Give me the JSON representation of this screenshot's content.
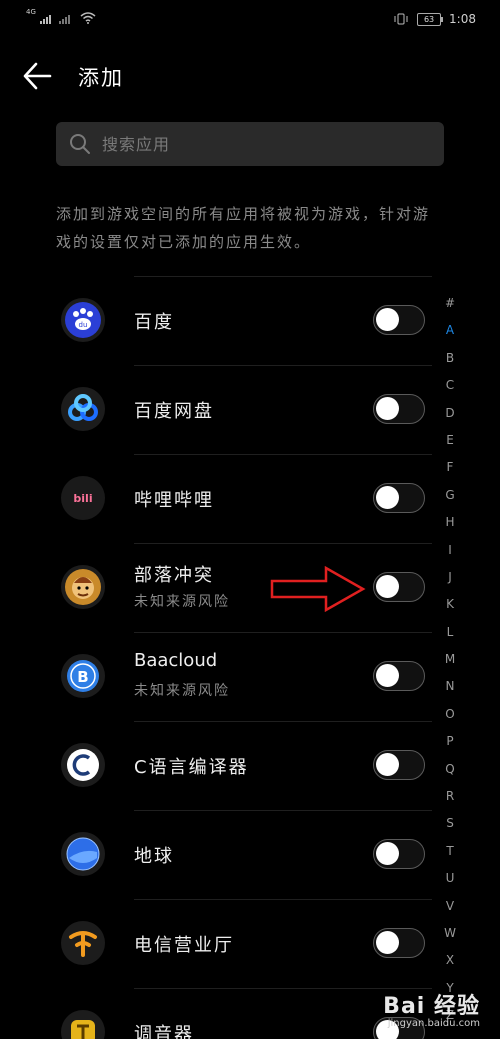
{
  "status_bar": {
    "network_label": "4G",
    "battery_level": "63",
    "time": "1:08"
  },
  "header": {
    "title": "添加",
    "back_icon": "arrow-left-icon"
  },
  "search": {
    "placeholder": "搜索应用",
    "value": ""
  },
  "description": "添加到游戏空间的所有应用将被视为游戏，针对游戏的设置仅对已添加的应用生效。",
  "apps": [
    {
      "name": "百度",
      "subtitle": "",
      "icon": "baidu-icon",
      "enabled": false
    },
    {
      "name": "百度网盘",
      "subtitle": "",
      "icon": "baidu-netdisk-icon",
      "enabled": false
    },
    {
      "name": "哔哩哔哩",
      "subtitle": "",
      "icon": "bilibili-icon",
      "enabled": false
    },
    {
      "name": "部落冲突",
      "subtitle": "未知来源风险",
      "icon": "clash-of-clans-icon",
      "enabled": false
    },
    {
      "name": "Baacloud",
      "subtitle": "未知来源风险",
      "icon": "baacloud-icon",
      "enabled": false
    },
    {
      "name": "C语言编译器",
      "subtitle": "",
      "icon": "c-compiler-icon",
      "enabled": false
    },
    {
      "name": "地球",
      "subtitle": "",
      "icon": "earth-icon",
      "enabled": false
    },
    {
      "name": "电信营业厅",
      "subtitle": "",
      "icon": "telecom-icon",
      "enabled": false
    },
    {
      "name": "调音器",
      "subtitle": "",
      "icon": "tuner-icon",
      "enabled": false
    }
  ],
  "alpha_index": {
    "letters": [
      "#",
      "A",
      "B",
      "C",
      "D",
      "E",
      "F",
      "G",
      "H",
      "I",
      "J",
      "K",
      "L",
      "M",
      "N",
      "O",
      "P",
      "Q",
      "R",
      "S",
      "T",
      "U",
      "V",
      "W",
      "X",
      "Y",
      "Z"
    ],
    "active": "A",
    "active_color": "#1e88e5"
  },
  "watermark": {
    "main": "Bai 经验",
    "sub": "jingyan.baidu.com"
  },
  "colors": {
    "background": "#000000",
    "annotation_arrow": "#e02020"
  }
}
